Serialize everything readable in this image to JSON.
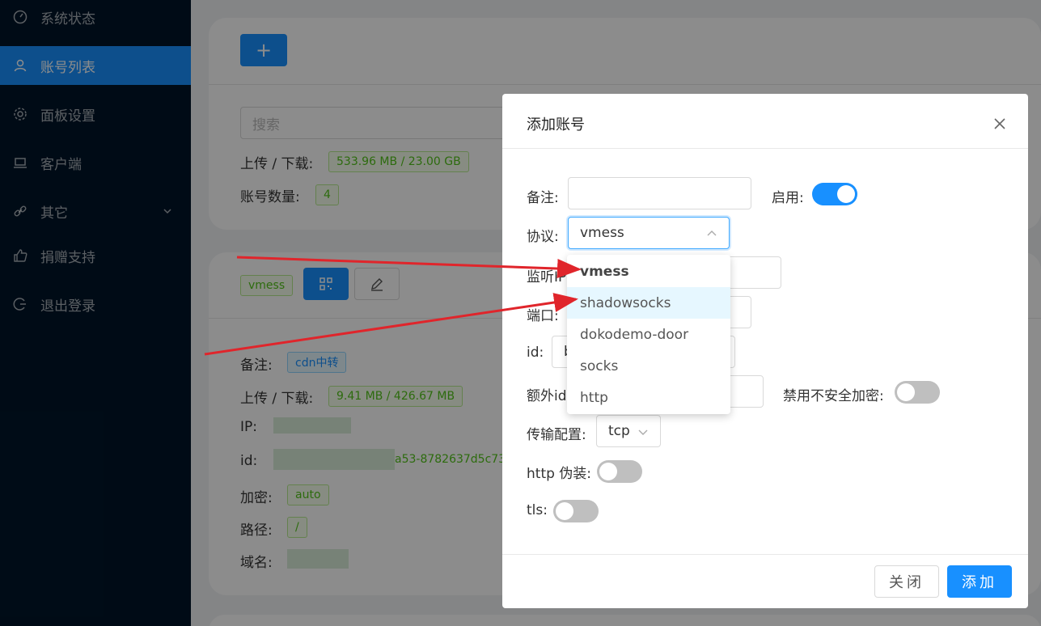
{
  "sidebar": {
    "items": [
      {
        "label": "系统状态",
        "icon": "dashboard-icon"
      },
      {
        "label": "账号列表",
        "icon": "user-icon",
        "active": true
      },
      {
        "label": "面板设置",
        "icon": "gear-icon"
      },
      {
        "label": "客户端",
        "icon": "laptop-icon"
      },
      {
        "label": "其它",
        "icon": "link-icon"
      },
      {
        "label": "捐赠支持",
        "icon": "like-icon"
      },
      {
        "label": "退出登录",
        "icon": "logout-icon"
      }
    ]
  },
  "main": {
    "add_button": "+",
    "search_placeholder": "搜索",
    "upload_download_label": "上传 / 下载:",
    "total_traffic": "533.96 MB / 23.00 GB",
    "account_count_label": "账号数量:",
    "account_count": "4",
    "account": {
      "protocol_tag": "vmess",
      "remark_label": "备注:",
      "remark_value": "cdn中转",
      "traffic_label": "上传 / 下载:",
      "traffic_value": "9.41 MB / 426.67 MB",
      "ip_label": "IP:",
      "id_label": "id:",
      "id_value_partial": "a53-8782637d5c73",
      "encryption_label": "加密:",
      "encryption_value": "auto",
      "path_label": "路径:",
      "path_value": "/",
      "domain_label": "域名:"
    }
  },
  "modal": {
    "title": "添加账号",
    "remark_label": "备注:",
    "remark_value": "",
    "enable_label": "启用:",
    "enable_on": true,
    "protocol_label": "协议:",
    "protocol_value": "vmess",
    "listen_ip_label": "监听IP",
    "port_label": "端口:",
    "id_label": "id:",
    "id_value_partial": "b",
    "alter_id_label": "额外id",
    "disable_insecure_label": "禁用不安全加密:",
    "transport_label": "传输配置:",
    "transport_value": "tcp",
    "http_label": "http 伪装:",
    "tls_label": "tls:",
    "close_button": "关闭",
    "add_button": "添加",
    "protocol_options": [
      "vmess",
      "shadowsocks",
      "dokodemo-door",
      "socks",
      "http"
    ]
  },
  "colors": {
    "primary": "#1890ff",
    "sidebar_bg": "#001529",
    "annotation_arrow": "#e0252b"
  }
}
